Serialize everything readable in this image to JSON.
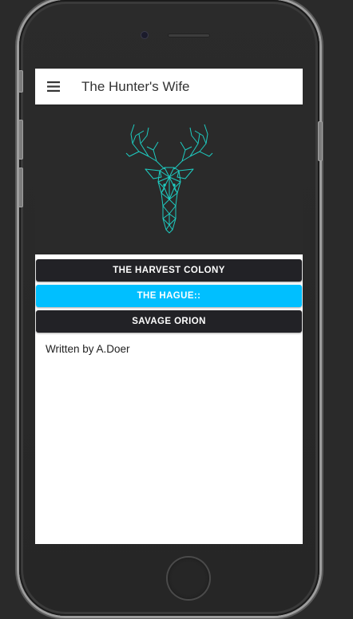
{
  "header": {
    "title": "The Hunter's Wife",
    "menu_icon": "hamburger-menu-icon"
  },
  "hero": {
    "image_icon": "geometric-stag-head-icon",
    "accent_color": "#1ecbc0"
  },
  "nav": {
    "items": [
      {
        "label": "THE HARVEST COLONY",
        "active": false
      },
      {
        "label": "THE HAGUE::",
        "active": true
      },
      {
        "label": "SAVAGE ORION",
        "active": false
      }
    ],
    "active_color": "#00bfff",
    "default_color": "#222226"
  },
  "content": {
    "credit": "Written by A.Doer"
  }
}
